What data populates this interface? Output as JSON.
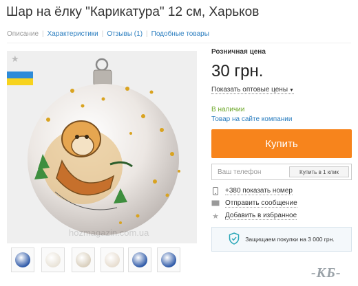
{
  "header": {
    "title": "Шар на ёлку \"Карикатура\" 12 см, Харьков"
  },
  "tabs": [
    {
      "label": "Описание"
    },
    {
      "label": "Характеристики"
    },
    {
      "label": "Отзывы (1)"
    },
    {
      "label": "Подобные товары"
    }
  ],
  "gallery": {
    "watermark": "hozmagazin.com.ua",
    "flag_colors": {
      "top": "#2e8bd8",
      "bottom": "#f7d31e"
    },
    "thumbnails": [
      {
        "color": "#2f5aa8",
        "icon": "ornament-thumb-icon"
      },
      {
        "color": "#e9e3d8",
        "icon": "ornament-thumb-icon"
      },
      {
        "color": "#d9cfbd",
        "icon": "ornament-thumb-icon"
      },
      {
        "color": "#e7ddd0",
        "icon": "ornament-thumb-icon"
      },
      {
        "color": "#2f5aa8",
        "icon": "ornament-thumb-icon"
      },
      {
        "color": "#2f5aa8",
        "icon": "ornament-thumb-icon"
      }
    ]
  },
  "pricing": {
    "retail_label": "Розничная цена",
    "price": "30 грн.",
    "wholesale_label": "Показать оптовые цены"
  },
  "status": {
    "stock": "В наличии",
    "site_link": "Товар на сайте компании"
  },
  "buy": {
    "label": "Купить",
    "color": "#f7841c"
  },
  "phone": {
    "placeholder": "Ваш телефон",
    "quick_buy_label": "Купить в 1 клик"
  },
  "actions": {
    "phone": "+380 показать номер",
    "message": "Отправить сообщение",
    "favorite": "Добавить в избранное"
  },
  "protection": {
    "text": "Защищаем покупки на 3 000 грн."
  },
  "corner_logo": "-КБ-"
}
